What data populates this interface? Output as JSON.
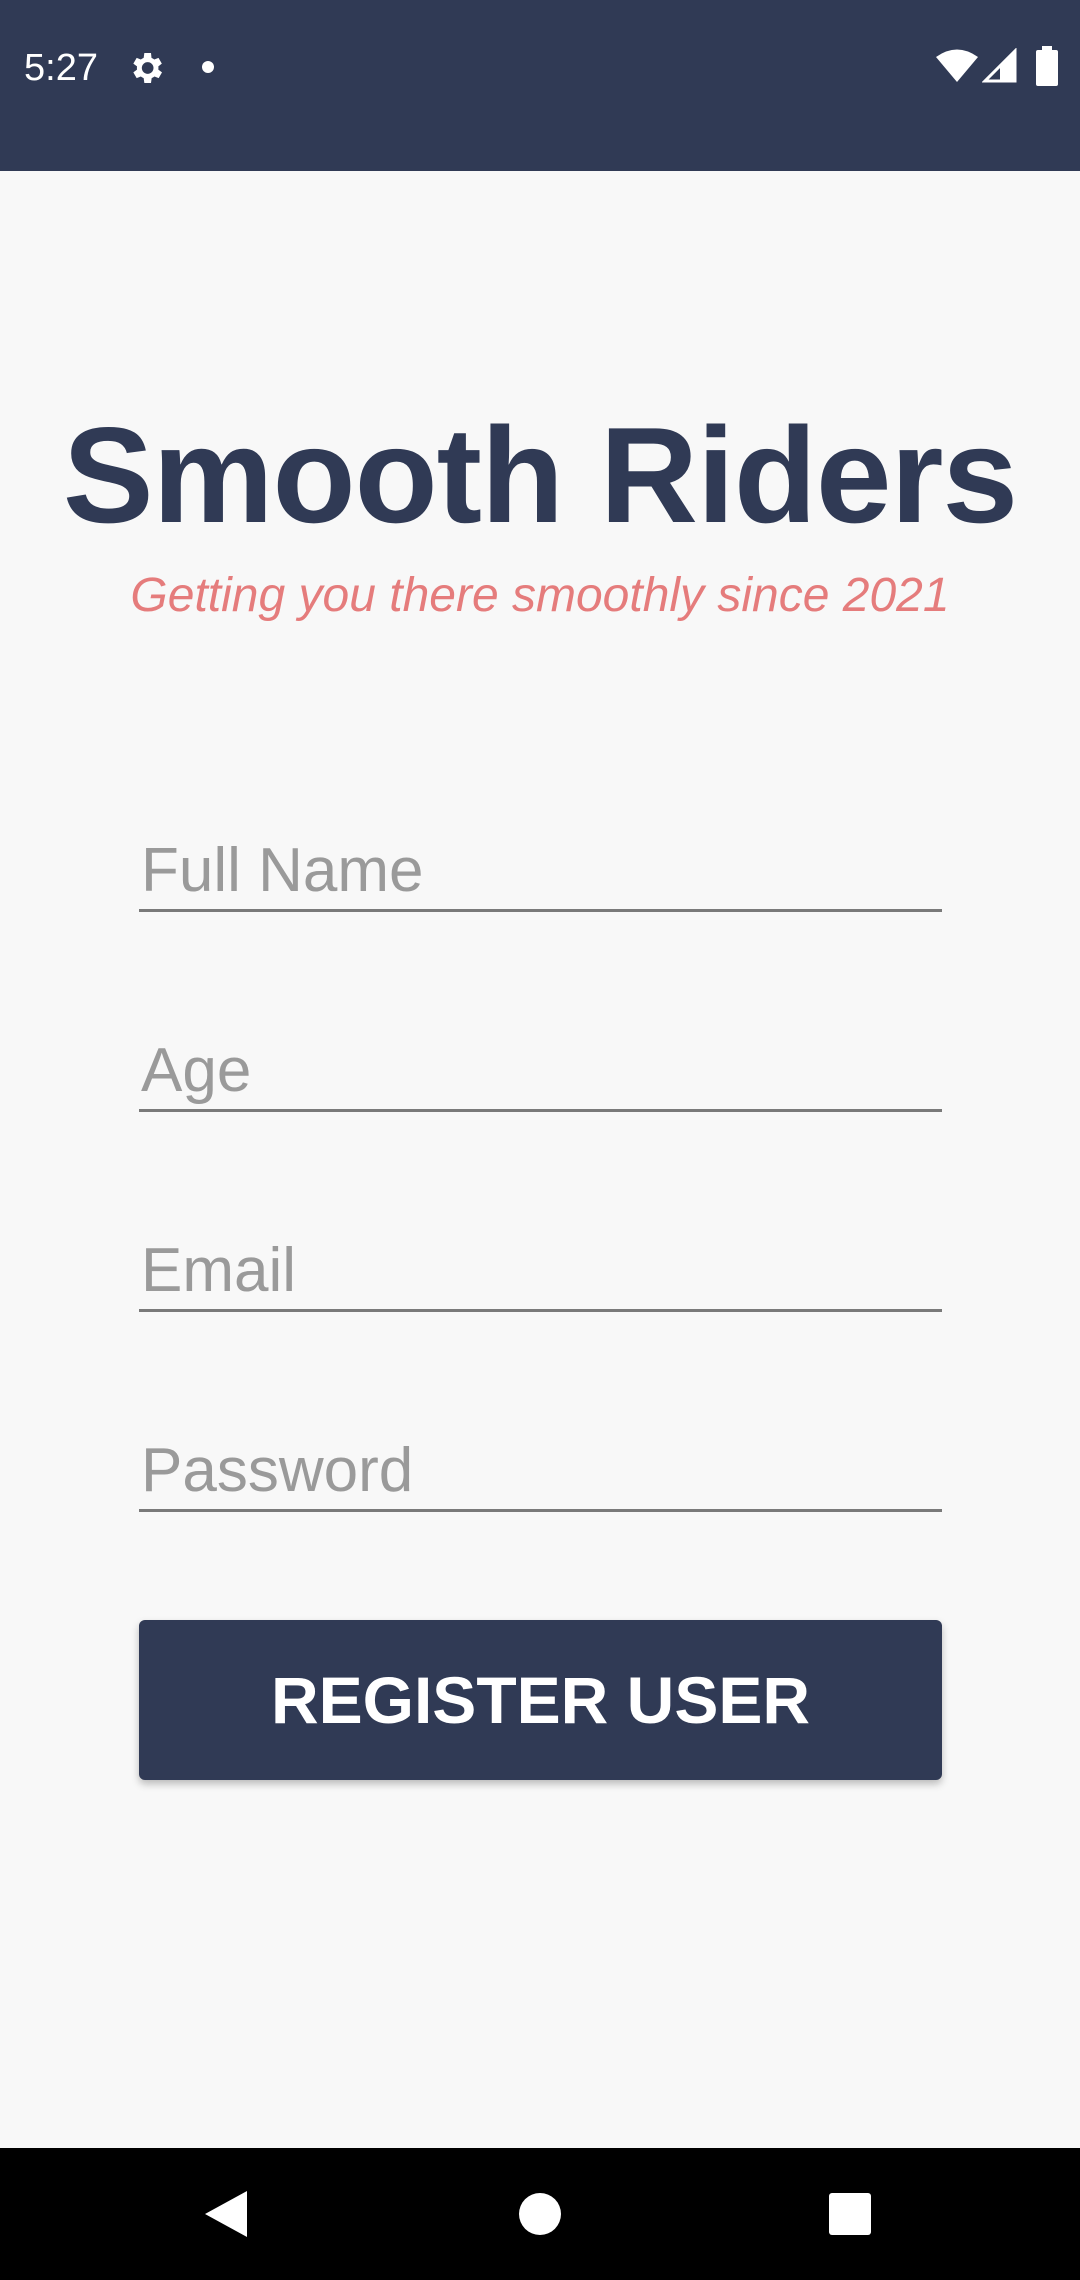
{
  "status_bar": {
    "time": "5:27"
  },
  "app": {
    "title": "Smooth Riders",
    "subtitle": "Getting you there smoothly since 2021"
  },
  "form": {
    "full_name_placeholder": "Full Name",
    "age_placeholder": "Age",
    "email_placeholder": "Email",
    "password_placeholder": "Password",
    "register_label": "REGISTER USER"
  },
  "colors": {
    "primary": "#303a55",
    "accent": "#e57c7c",
    "background": "#f8f8f8"
  },
  "icons": [
    "gear-icon",
    "notification-dot-icon",
    "wifi-icon",
    "signal-icon",
    "battery-icon",
    "back-icon",
    "home-icon",
    "recents-icon"
  ]
}
